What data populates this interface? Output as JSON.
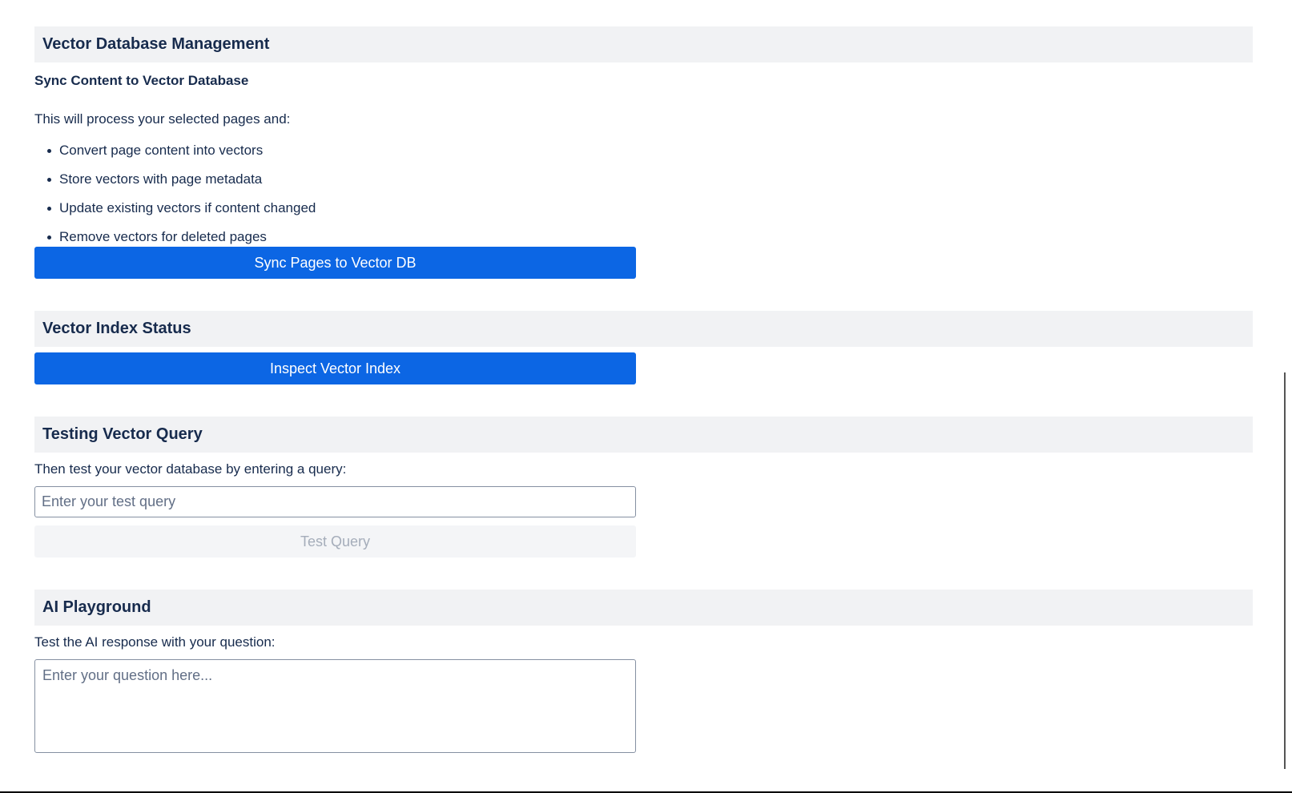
{
  "vector_db": {
    "title": "Vector Database Management",
    "sync_heading": "Sync Content to Vector Database",
    "intro": "This will process your selected pages and:",
    "bullets": [
      "Convert page content into vectors",
      "Store vectors with page metadata",
      "Update existing vectors if content changed",
      "Remove vectors for deleted pages"
    ],
    "sync_button": "Sync Pages to Vector DB"
  },
  "index_status": {
    "title": "Vector Index Status",
    "inspect_button": "Inspect Vector Index"
  },
  "testing": {
    "title": "Testing Vector Query",
    "description": "Then test your vector database by entering a query:",
    "query_placeholder": "Enter your test query",
    "query_value": "",
    "test_button": "Test Query"
  },
  "playground": {
    "title": "AI Playground",
    "description": "Test the AI response with your question:",
    "question_placeholder": "Enter your question here..."
  },
  "colors": {
    "primary_button": "#0c66e4",
    "section_header_bg": "#f1f2f4",
    "text": "#172b4d"
  }
}
